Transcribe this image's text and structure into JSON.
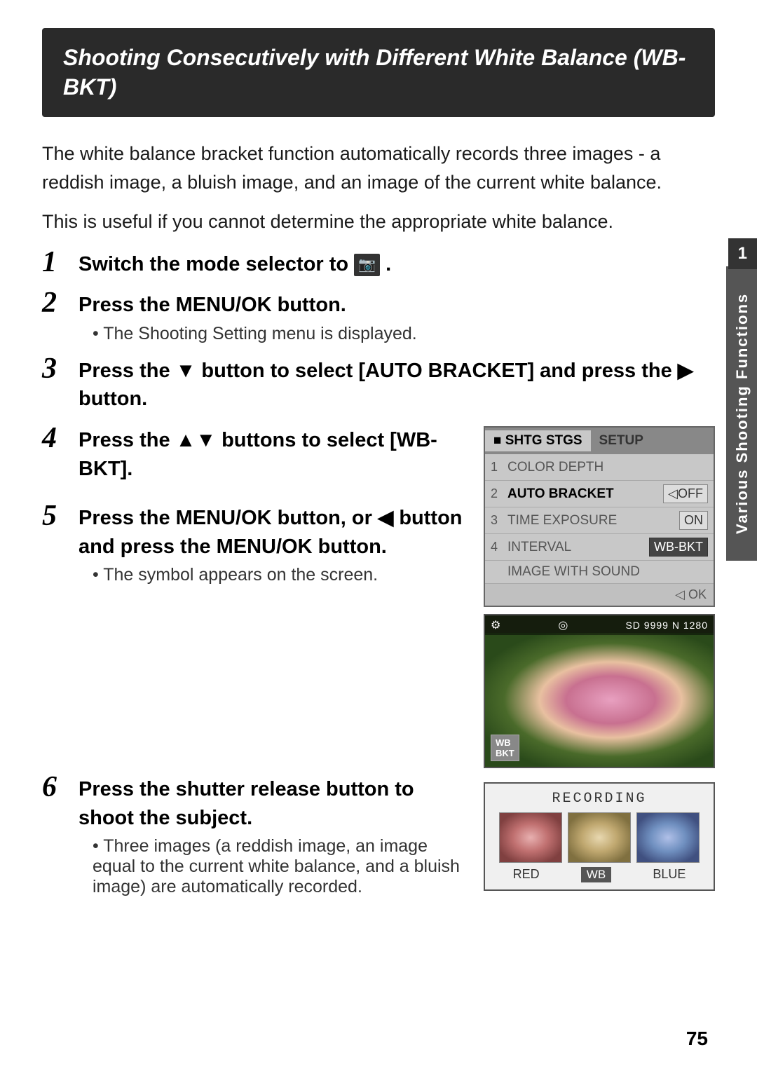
{
  "header": {
    "title": "Shooting Consecutively with Different White Balance (WB-BKT)"
  },
  "intro": {
    "para1": "The white balance bracket function automatically records three images - a reddish image, a bluish image, and an image of the current white balance.",
    "para2": "This is useful if you cannot determine the appropriate white balance."
  },
  "steps": [
    {
      "number": "1",
      "title": "Switch the mode selector to",
      "title_suffix": ".",
      "has_camera_icon": true
    },
    {
      "number": "2",
      "title": "Press the MENU/OK button.",
      "sub": "The Shooting Setting menu is displayed."
    },
    {
      "number": "3",
      "title": "Press the ▼ button to select [AUTO BRACKET] and press the ▶ button."
    },
    {
      "number": "4",
      "title": "Press the ▲▼ buttons to select [WB-BKT]."
    },
    {
      "number": "5",
      "title": "Press the MENU/OK button, or ◀ button and press the MENU/OK button.",
      "sub": "The symbol appears on the screen."
    },
    {
      "number": "6",
      "title": "Press the shutter release button to shoot the subject.",
      "sub": "Three images (a reddish image, an image equal to the current white balance, and a bluish image) are automatically recorded."
    }
  ],
  "menu": {
    "tabs": [
      "SHTG STGS",
      "SETUP"
    ],
    "active_tab": "SHTG STGS",
    "rows": [
      {
        "num": "1",
        "label": "COLOR DEPTH",
        "value": ""
      },
      {
        "num": "2",
        "label": "AUTO BRACKET",
        "value": "OFF"
      },
      {
        "num": "3",
        "label": "TIME EXPOSURE",
        "value": "ON"
      },
      {
        "num": "4",
        "label": "INTERVAL",
        "value": "WB-BKT"
      },
      {
        "num": "",
        "label": "IMAGE WITH SOUND",
        "value": ""
      }
    ],
    "footer": "◁ OK"
  },
  "recording": {
    "label": "RECORDING",
    "labels": [
      "RED",
      "WB",
      "BLUE"
    ]
  },
  "sidebar": {
    "label": "Various Shooting Functions"
  },
  "page_number": "75"
}
